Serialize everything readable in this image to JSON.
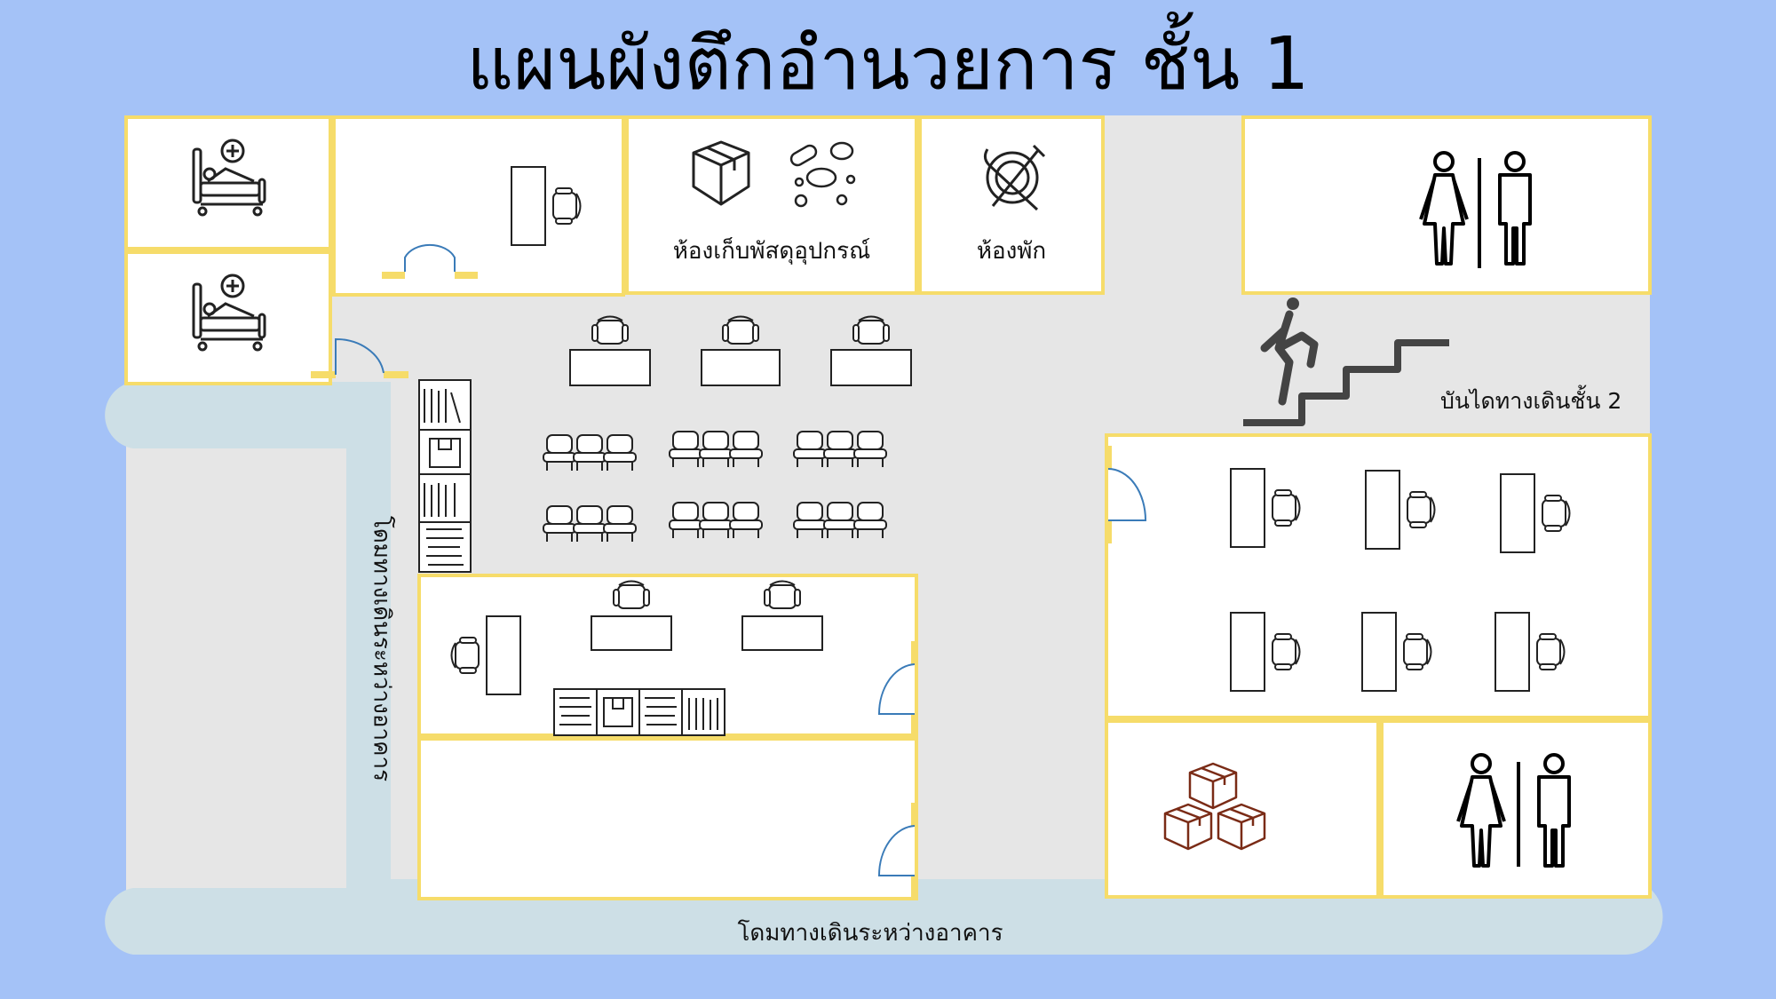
{
  "title": "แผนผังตึกอำนวยการ ชั้น 1",
  "labels": {
    "storage_room": "ห้องเก็บพัสดุอุปกรณ์",
    "break_room": "ห้องพัก",
    "stairs": "บันไดทางเดินชั้น 2",
    "walkway_vertical": "โดมทางเดินระหว่างอาคาร",
    "walkway_bottom": "โดมทางเดินระหว่างอาคาร"
  },
  "icons": {
    "patient_bed_1": "patient-bed-icon",
    "patient_bed_2": "patient-bed-icon",
    "supply_box": "cardboard-box-icon",
    "pills": "pills-icon",
    "dining": "plate-spoon-fork-icon",
    "restroom_top": "restroom-icon",
    "restroom_bottom": "restroom-icon",
    "stairs_person": "person-climbing-stairs-icon",
    "boxes_stack": "stacked-boxes-icon"
  },
  "colors": {
    "background": "#a4c2f7",
    "floor": "#e6e6e6",
    "room_fill": "#ffffff",
    "wall": "#f6dc6a",
    "walkway": "#cddfe6",
    "door_arc": "#3a7bb8",
    "boxes": "#7a2b16"
  }
}
